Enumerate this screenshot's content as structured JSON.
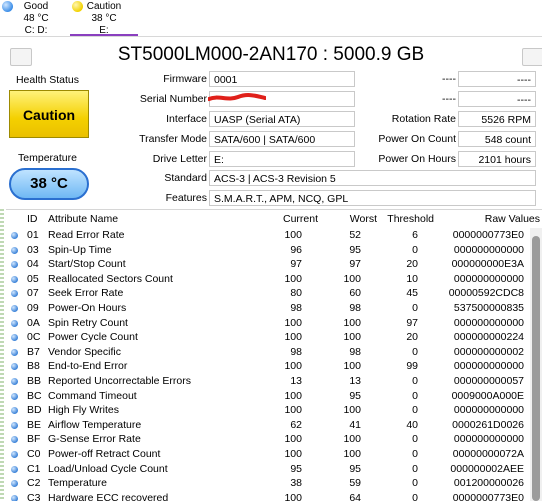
{
  "disks": [
    {
      "status": "Good",
      "temp": "48 °C",
      "letters": "C: D:",
      "color": "#3c8ee8"
    },
    {
      "status": "Caution",
      "temp": "38 °C",
      "letters": "E:",
      "color": "#f2d200"
    }
  ],
  "title": "ST5000LM000-2AN170 : 5000.9 GB",
  "health": {
    "label": "Health Status",
    "value": "Caution",
    "color": "#f4d000"
  },
  "temperature": {
    "label": "Temperature",
    "value": "38 °C"
  },
  "info": {
    "firmware": {
      "label": "Firmware",
      "value": "0001"
    },
    "serial": {
      "label": "Serial Number",
      "value": ""
    },
    "interface": {
      "label": "Interface",
      "value": "UASP (Serial ATA)"
    },
    "transfer": {
      "label": "Transfer Mode",
      "value": "SATA/600 | SATA/600"
    },
    "drive_letter": {
      "label": "Drive Letter",
      "value": "E:"
    },
    "standard": {
      "label": "Standard",
      "value": "ACS-3 | ACS-3 Revision 5"
    },
    "features": {
      "label": "Features",
      "value": "S.M.A.R.T., APM, NCQ, GPL"
    },
    "right1": {
      "label": "----",
      "value": "----"
    },
    "right2": {
      "label": "----",
      "value": "----"
    },
    "rotation": {
      "label": "Rotation Rate",
      "value": "5526 RPM"
    },
    "power_count": {
      "label": "Power On Count",
      "value": "548 count"
    },
    "power_hours": {
      "label": "Power On Hours",
      "value": "2101 hours"
    }
  },
  "table": {
    "headers": {
      "id": "ID",
      "name": "Attribute Name",
      "current": "Current",
      "worst": "Worst",
      "threshold": "Threshold",
      "raw": "Raw Values"
    },
    "rows": [
      {
        "id": "01",
        "name": "Read Error Rate",
        "current": "100",
        "worst": "52",
        "threshold": "6",
        "raw": "0000000773E0"
      },
      {
        "id": "03",
        "name": "Spin-Up Time",
        "current": "96",
        "worst": "95",
        "threshold": "0",
        "raw": "000000000000"
      },
      {
        "id": "04",
        "name": "Start/Stop Count",
        "current": "97",
        "worst": "97",
        "threshold": "20",
        "raw": "000000000E3A"
      },
      {
        "id": "05",
        "name": "Reallocated Sectors Count",
        "current": "100",
        "worst": "100",
        "threshold": "10",
        "raw": "000000000000"
      },
      {
        "id": "07",
        "name": "Seek Error Rate",
        "current": "80",
        "worst": "60",
        "threshold": "45",
        "raw": "00000592CDC8"
      },
      {
        "id": "09",
        "name": "Power-On Hours",
        "current": "98",
        "worst": "98",
        "threshold": "0",
        "raw": "537500000835"
      },
      {
        "id": "0A",
        "name": "Spin Retry Count",
        "current": "100",
        "worst": "100",
        "threshold": "97",
        "raw": "000000000000"
      },
      {
        "id": "0C",
        "name": "Power Cycle Count",
        "current": "100",
        "worst": "100",
        "threshold": "20",
        "raw": "000000000224"
      },
      {
        "id": "B7",
        "name": "Vendor Specific",
        "current": "98",
        "worst": "98",
        "threshold": "0",
        "raw": "000000000002"
      },
      {
        "id": "B8",
        "name": "End-to-End Error",
        "current": "100",
        "worst": "100",
        "threshold": "99",
        "raw": "000000000000"
      },
      {
        "id": "BB",
        "name": "Reported Uncorrectable Errors",
        "current": "13",
        "worst": "13",
        "threshold": "0",
        "raw": "000000000057"
      },
      {
        "id": "BC",
        "name": "Command Timeout",
        "current": "100",
        "worst": "95",
        "threshold": "0",
        "raw": "0009000A000E"
      },
      {
        "id": "BD",
        "name": "High Fly Writes",
        "current": "100",
        "worst": "100",
        "threshold": "0",
        "raw": "000000000000"
      },
      {
        "id": "BE",
        "name": "Airflow Temperature",
        "current": "62",
        "worst": "41",
        "threshold": "40",
        "raw": "0000261D0026"
      },
      {
        "id": "BF",
        "name": "G-Sense Error Rate",
        "current": "100",
        "worst": "100",
        "threshold": "0",
        "raw": "000000000000"
      },
      {
        "id": "C0",
        "name": "Power-off Retract Count",
        "current": "100",
        "worst": "100",
        "threshold": "0",
        "raw": "00000000072A"
      },
      {
        "id": "C1",
        "name": "Load/Unload Cycle Count",
        "current": "95",
        "worst": "95",
        "threshold": "0",
        "raw": "000000002AEE"
      },
      {
        "id": "C2",
        "name": "Temperature",
        "current": "38",
        "worst": "59",
        "threshold": "0",
        "raw": "001200000026"
      },
      {
        "id": "C3",
        "name": "Hardware ECC recovered",
        "current": "100",
        "worst": "64",
        "threshold": "0",
        "raw": "0000000773E0"
      }
    ]
  }
}
